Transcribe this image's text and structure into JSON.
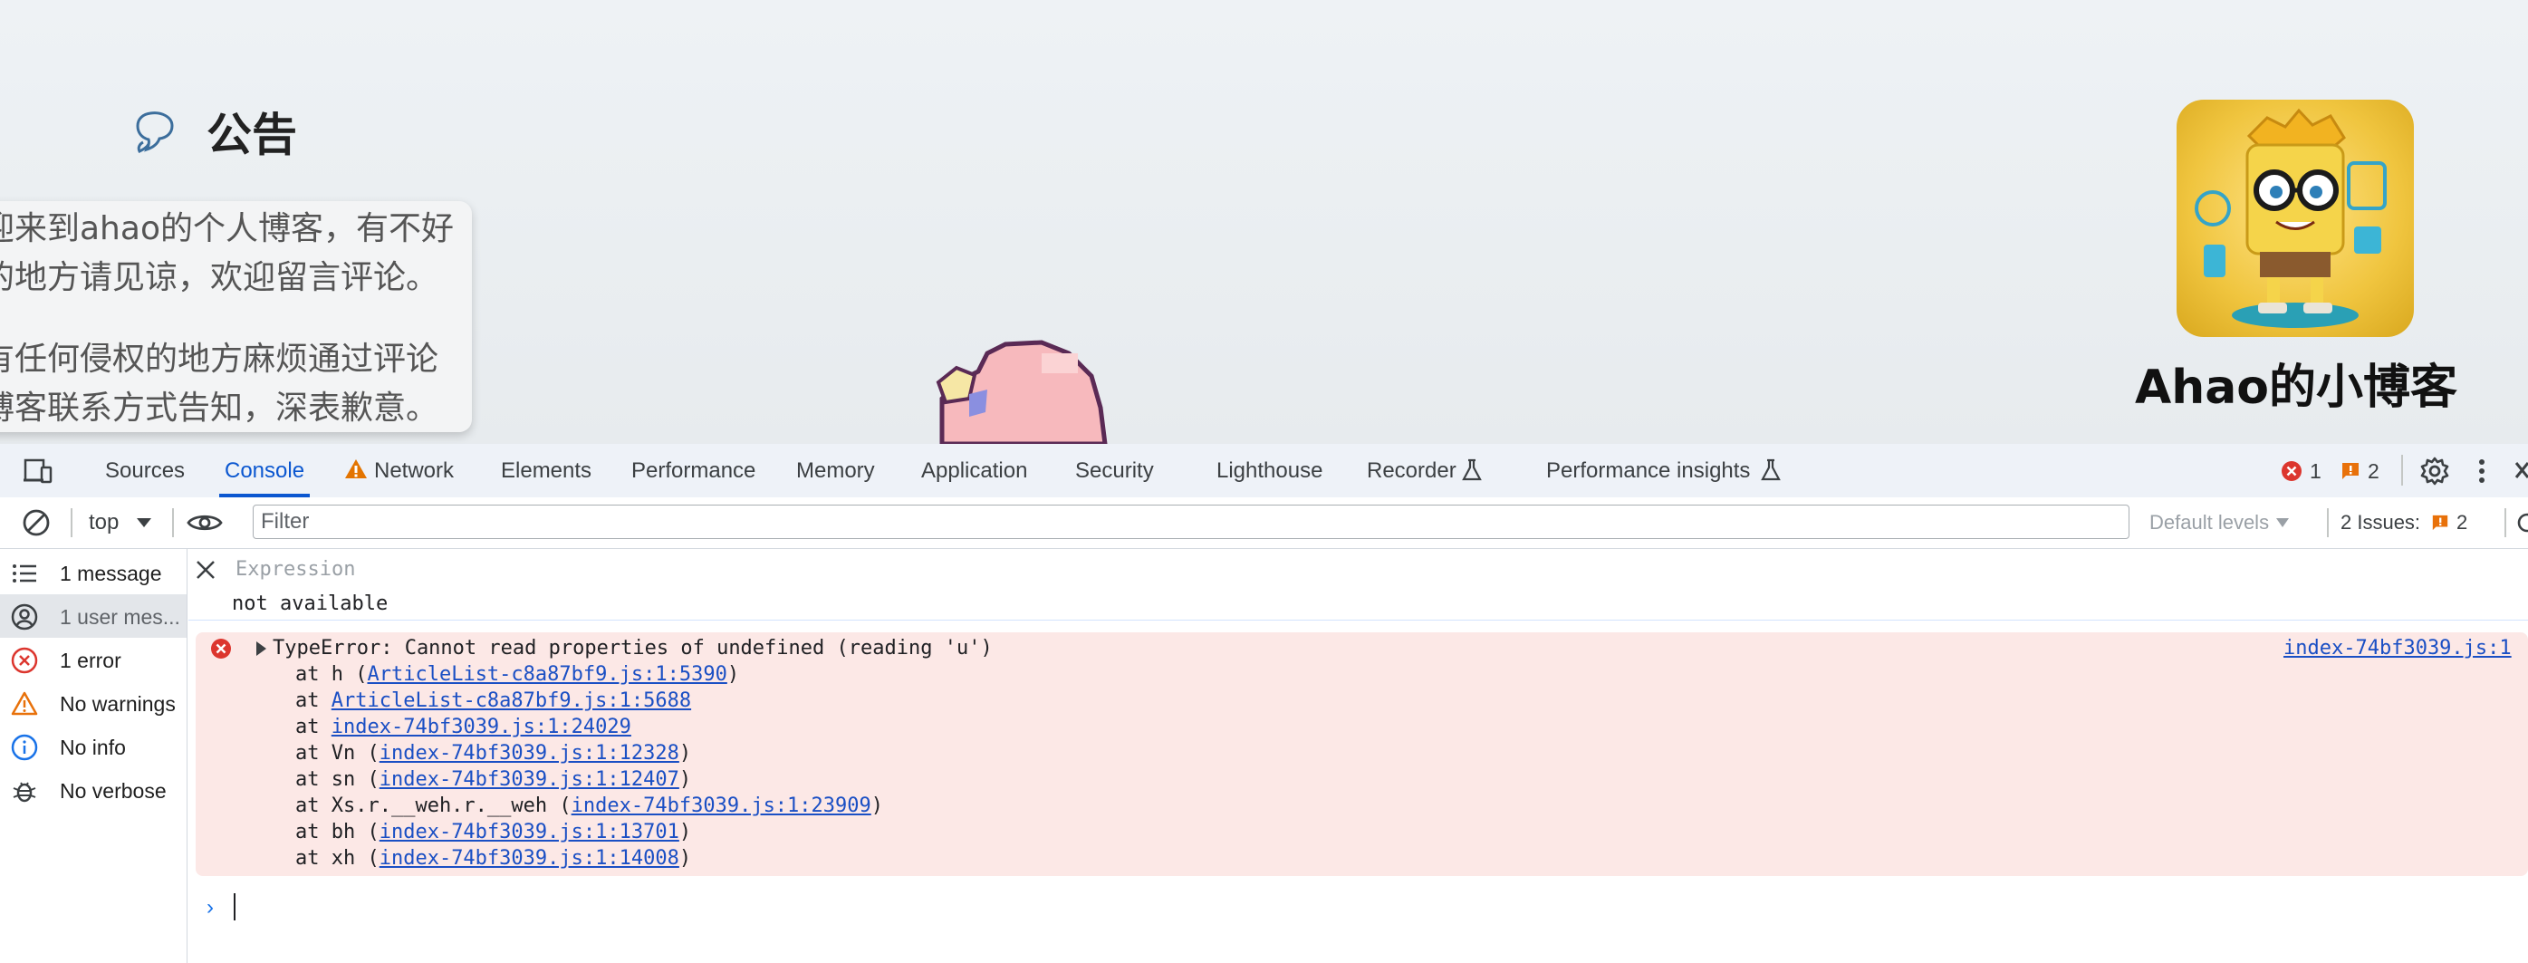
{
  "webpage": {
    "notice": {
      "title": "公告",
      "lines": [
        "迎来到ahao的个人博客，有不好",
        "的地方请见谅，欢迎留言评论。",
        "有任何侵权的地方麻烦通过评论",
        "博客联系方式告知，深表歉意。"
      ]
    },
    "blog_name": "Ahao的小博客"
  },
  "devtools": {
    "tabs": [
      {
        "label": "Sources"
      },
      {
        "label": "Console",
        "active": true
      },
      {
        "label": "Network",
        "warning": true
      },
      {
        "label": "Elements"
      },
      {
        "label": "Performance"
      },
      {
        "label": "Memory"
      },
      {
        "label": "Application"
      },
      {
        "label": "Security"
      },
      {
        "label": "Lighthouse"
      },
      {
        "label": "Recorder",
        "experimental": true
      },
      {
        "label": "Performance insights",
        "experimental": true
      }
    ],
    "error_count": "1",
    "warning_count": "2",
    "toolbar": {
      "context": "top",
      "filter_placeholder": "Filter",
      "levels": "Default levels",
      "issues_label": "2 Issues:",
      "issues_count": "2"
    },
    "sidebar": [
      {
        "label": "1 message",
        "icon": "list-icon"
      },
      {
        "label": "1 user mes...",
        "icon": "user-icon",
        "selected": true
      },
      {
        "label": "1 error",
        "icon": "error-icon"
      },
      {
        "label": "No warnings",
        "icon": "warning-icon"
      },
      {
        "label": "No info",
        "icon": "info-icon"
      },
      {
        "label": "No verbose",
        "icon": "bug-icon"
      }
    ],
    "expression": {
      "placeholder": "Expression",
      "value": "not available"
    },
    "error": {
      "message": "TypeError: Cannot read properties of undefined (reading 'u')",
      "source": "index-74bf3039.js:1",
      "stack": [
        {
          "prefix": "at h (",
          "link": "ArticleList-c8a87bf9.js:1:5390",
          "suffix": ")"
        },
        {
          "prefix": "at ",
          "link": "ArticleList-c8a87bf9.js:1:5688",
          "suffix": ""
        },
        {
          "prefix": "at ",
          "link": "index-74bf3039.js:1:24029",
          "suffix": ""
        },
        {
          "prefix": "at Vn (",
          "link": "index-74bf3039.js:1:12328",
          "suffix": ")"
        },
        {
          "prefix": "at sn (",
          "link": "index-74bf3039.js:1:12407",
          "suffix": ")"
        },
        {
          "prefix": "at Xs.r.__weh.r.__weh (",
          "link": "index-74bf3039.js:1:23909",
          "suffix": ")"
        },
        {
          "prefix": "at bh (",
          "link": "index-74bf3039.js:1:13701",
          "suffix": ")"
        },
        {
          "prefix": "at xh (",
          "link": "index-74bf3039.js:1:14008",
          "suffix": ")"
        }
      ]
    }
  }
}
